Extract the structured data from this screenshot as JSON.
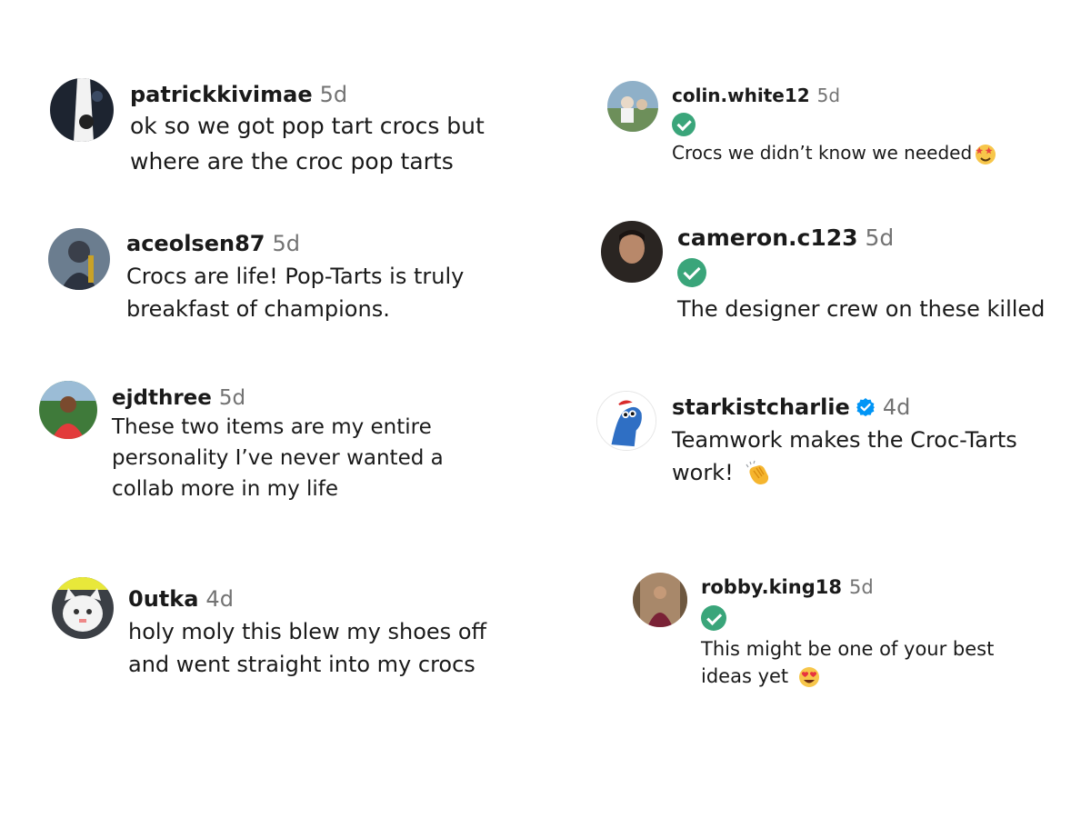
{
  "comments": [
    {
      "username": "patrickkivimae",
      "time": "5d",
      "lines": [
        "ok so we got pop tart crocs but",
        "where are the croc pop tarts"
      ]
    },
    {
      "username": "colin.white12",
      "time": "5d",
      "lines": [
        "Crocs we didn’t know we needed"
      ],
      "emoji": "star-struck-emoji"
    },
    {
      "username": "aceolsen87",
      "time": "5d",
      "lines": [
        "Crocs are life! Pop-Tarts is truly",
        "breakfast of champions."
      ]
    },
    {
      "username": "cameron.c123",
      "time": "5d",
      "lines": [
        "The designer crew on these killed"
      ]
    },
    {
      "username": "ejdthree",
      "time": "5d",
      "lines": [
        "These two items are my entire",
        "personality I’ve never wanted a",
        "collab more in my life"
      ]
    },
    {
      "username": "starkistcharlie",
      "time": "4d",
      "lines": [
        "Teamwork makes the Croc-Tarts",
        "work!"
      ],
      "emoji": "clapping-hands-emoji"
    },
    {
      "username": "0utka",
      "time": "4d",
      "lines": [
        "holy moly this blew my shoes off",
        "and went straight into my crocs"
      ]
    },
    {
      "username": "robby.king18",
      "time": "5d",
      "lines": [
        "This might be one of your best",
        "ideas yet"
      ],
      "emoji": "heart-eyes-emoji"
    }
  ],
  "colors": {
    "verified_green": "#3aa57a",
    "verified_blue": "#0095f6",
    "timestamp": "#737373"
  }
}
